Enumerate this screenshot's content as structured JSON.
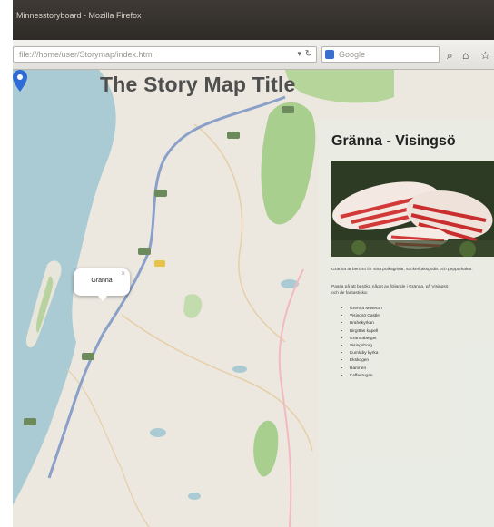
{
  "window": {
    "title": "Minnesstoryboard - Mozilla Firefox"
  },
  "browser": {
    "url": "file:///home/user/Storymap/index.html",
    "search_placeholder": "Google",
    "icons": [
      "search-icon",
      "home-icon",
      "bookmark-icon"
    ]
  },
  "map": {
    "title": "The Story Map Title",
    "popup": {
      "label": "Gränna",
      "close": "×"
    },
    "colors": {
      "water": "#aacbd4",
      "land": "#ece8e0",
      "forest": "#a8cf8e",
      "road": "#f2b9c0",
      "highway": "#8aa0c8",
      "marker": "#2f6bd6"
    }
  },
  "panel": {
    "heading": "Gränna - Visingsö",
    "image_alt": "Polkagrisar",
    "intro": "Gränna är berömt för sina polkagrisar, sockerkaksgodis och pepparkakor.",
    "details": "Passa på att besöka något av följande i Gränna, på Visingsö",
    "details_2": "och de fantastiska:",
    "list": [
      "Grenna Museum",
      "Visingsö Castle",
      "Brahekyrkan",
      "Birgittas kapell",
      "Grännaberget",
      "Visingsborg",
      "Kumlaby kyrka",
      "Ekskogen",
      "Hamnen",
      "Kaffestugan"
    ]
  }
}
